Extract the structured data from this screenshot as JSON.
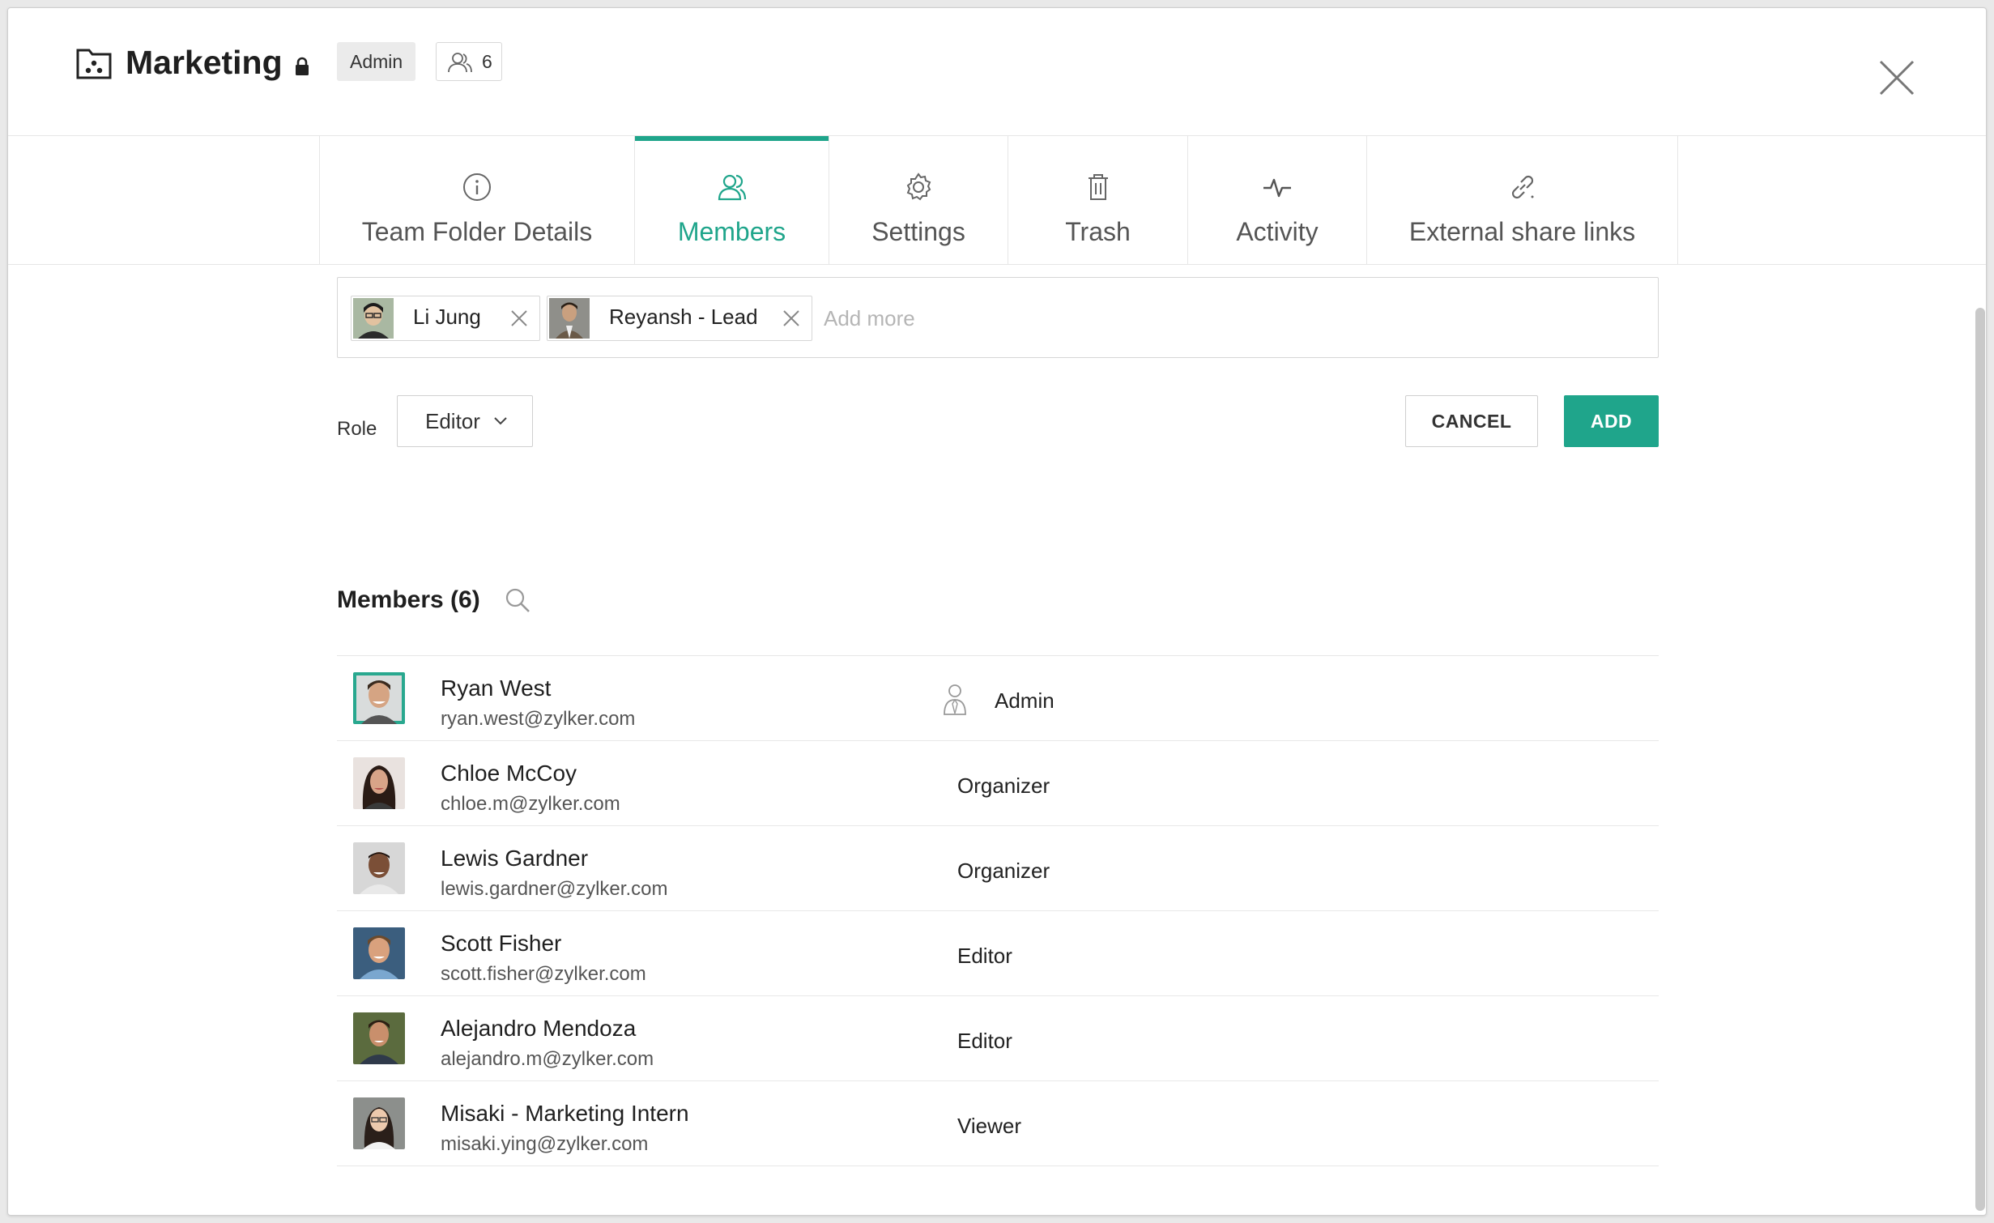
{
  "header": {
    "title": "Marketing",
    "role_badge": "Admin",
    "member_count": "6"
  },
  "tabs": [
    {
      "label": "Team Folder Details",
      "icon": "info-icon",
      "active": false
    },
    {
      "label": "Members",
      "icon": "members-icon",
      "active": true
    },
    {
      "label": "Settings",
      "icon": "gear-icon",
      "active": false
    },
    {
      "label": "Trash",
      "icon": "trash-icon",
      "active": false
    },
    {
      "label": "Activity",
      "icon": "activity-icon",
      "active": false
    },
    {
      "label": "External share links",
      "icon": "link-icon",
      "active": false
    }
  ],
  "add_members": {
    "chips": [
      {
        "name": "Li Jung"
      },
      {
        "name": "Reyansh - Lead"
      }
    ],
    "placeholder": "Add more",
    "role_label": "Role",
    "role_value": "Editor",
    "cancel_label": "CANCEL",
    "add_label": "ADD"
  },
  "members": {
    "title": "Members (6)",
    "list": [
      {
        "name": "Ryan West",
        "email": "ryan.west@zylker.com",
        "role": "Admin"
      },
      {
        "name": "Chloe McCoy",
        "email": "chloe.m@zylker.com",
        "role": "Organizer"
      },
      {
        "name": "Lewis Gardner",
        "email": "lewis.gardner@zylker.com",
        "role": "Organizer"
      },
      {
        "name": "Scott Fisher",
        "email": "scott.fisher@zylker.com",
        "role": "Editor"
      },
      {
        "name": "Alejandro Mendoza",
        "email": "alejandro.m@zylker.com",
        "role": "Editor"
      },
      {
        "name": "Misaki - Marketing Intern",
        "email": "misaki.ying@zylker.com",
        "role": "Viewer"
      }
    ]
  },
  "colors": {
    "accent": "#1fa58b"
  }
}
